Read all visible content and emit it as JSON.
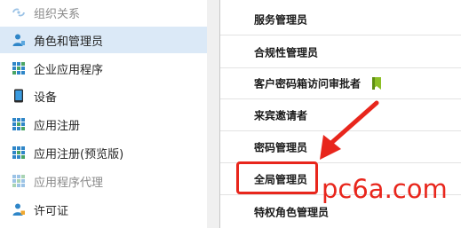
{
  "nav": {
    "items": [
      {
        "label": "组织关系",
        "icon": "org-relations-icon",
        "dim": true
      },
      {
        "label": "角色和管理员",
        "icon": "user-role-icon",
        "selected": true
      },
      {
        "label": "企业应用程序",
        "icon": "enterprise-apps-icon"
      },
      {
        "label": "设备",
        "icon": "device-icon"
      },
      {
        "label": "应用注册",
        "icon": "app-registrations-icon"
      },
      {
        "label": "应用注册(预览版)",
        "icon": "app-registrations-preview-icon"
      },
      {
        "label": "应用程序代理",
        "icon": "app-proxy-icon",
        "dim": true
      },
      {
        "label": "许可证",
        "icon": "license-icon"
      }
    ]
  },
  "roles": {
    "items": [
      {
        "label": "服务管理员"
      },
      {
        "label": "合规性管理员"
      },
      {
        "label": "客户密码箱访问审批者",
        "badge": "preview-flag-icon"
      },
      {
        "label": "来宾邀请者"
      },
      {
        "label": "密码管理员"
      },
      {
        "label": "全局管理员",
        "highlighted": true
      },
      {
        "label": "特权角色管理员"
      }
    ]
  },
  "annotation": {
    "watermark": "pc6a.com",
    "color": "#e8261c"
  }
}
